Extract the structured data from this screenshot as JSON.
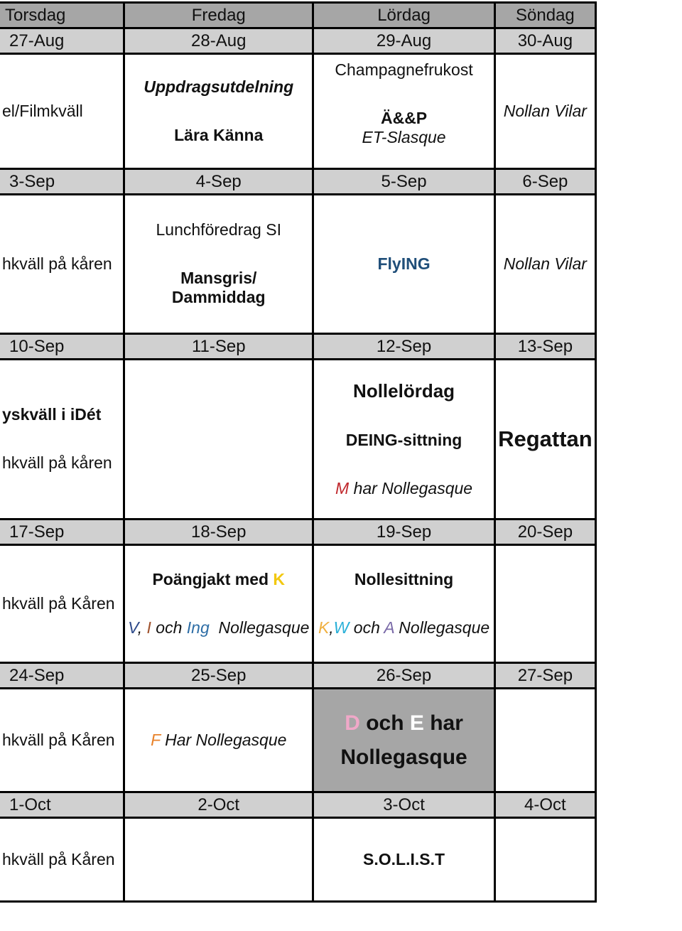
{
  "header": {
    "days": [
      "Torsdag",
      "Fredag",
      "Lördag",
      "Söndag"
    ]
  },
  "weeks": [
    {
      "dates": [
        "27-Aug",
        "28-Aug",
        "29-Aug",
        "30-Aug"
      ],
      "thu": [
        "el/Filmkväll"
      ],
      "fri": [
        "Uppdragsutdelning",
        "Lära Känna"
      ],
      "sat": [
        "Champagnefrukost",
        "Ä&&P",
        "ET-Slasque"
      ],
      "sun": [
        "Nollan Vilar"
      ]
    },
    {
      "dates": [
        "3-Sep",
        "4-Sep",
        "5-Sep",
        "6-Sep"
      ],
      "thu": [
        "hkväll på kåren"
      ],
      "fri": [
        "Lunchföredrag SI",
        "Mansgris/",
        "Dammiddag"
      ],
      "sat": [
        "FlyING"
      ],
      "sun": [
        "Nollan Vilar"
      ]
    },
    {
      "dates": [
        "10-Sep",
        "11-Sep",
        "12-Sep",
        "13-Sep"
      ],
      "thu": [
        "yskväll i iDét",
        "hkväll på kåren"
      ],
      "fri": [],
      "sat": [
        "Nollelördag",
        "DEING-sittning",
        {
          "prefix": "M",
          "text": " har Nollegasque"
        }
      ],
      "sun": [
        "Regattan"
      ]
    },
    {
      "dates": [
        "17-Sep",
        "18-Sep",
        "19-Sep",
        "20-Sep"
      ],
      "thu": [
        "hkväll på Kåren"
      ],
      "fri": {
        "title": "Poängjakt med ",
        "title_accent": "K",
        "parts": [
          "V",
          ", ",
          "I",
          " och ",
          "Ing",
          "  Nollegasque"
        ]
      },
      "sat": {
        "title": "Nollesittning",
        "parts": [
          "K",
          ",",
          "W",
          " och ",
          "A",
          " Nollegasque"
        ]
      },
      "sun": []
    },
    {
      "dates": [
        "24-Sep",
        "25-Sep",
        "26-Sep",
        "27-Sep"
      ],
      "thu": [
        "hkväll på Kåren"
      ],
      "fri": {
        "prefix": "F",
        "text": " Har Nollegasque"
      },
      "sat": {
        "d": "D",
        "och": " och ",
        "e": "E",
        "har": " har",
        "line2": "Nollegasque"
      },
      "sun": []
    },
    {
      "dates": [
        "1-Oct",
        "2-Oct",
        "3-Oct",
        "4-Oct"
      ],
      "thu": [
        "hkväll på Kåren"
      ],
      "fri": [],
      "sat": [
        "S.O.L.I.S.T"
      ],
      "sun": []
    }
  ],
  "colors": {
    "header_bg": "#a6a6a6",
    "date_bg": "#d0d0d0",
    "highlight_bg": "#a6a6a6",
    "flying": "#1f4e79",
    "M": "#c0282d",
    "K_yellow": "#f2c80f",
    "V": "#2e4a8a",
    "I": "#a0522d",
    "Ing": "#2e6ea6",
    "K_orange": "#f0b040",
    "W": "#2ab0d8",
    "A": "#7a6aa8",
    "F": "#e8822a",
    "D": "#f0a8c8",
    "E": "#ffffff"
  }
}
